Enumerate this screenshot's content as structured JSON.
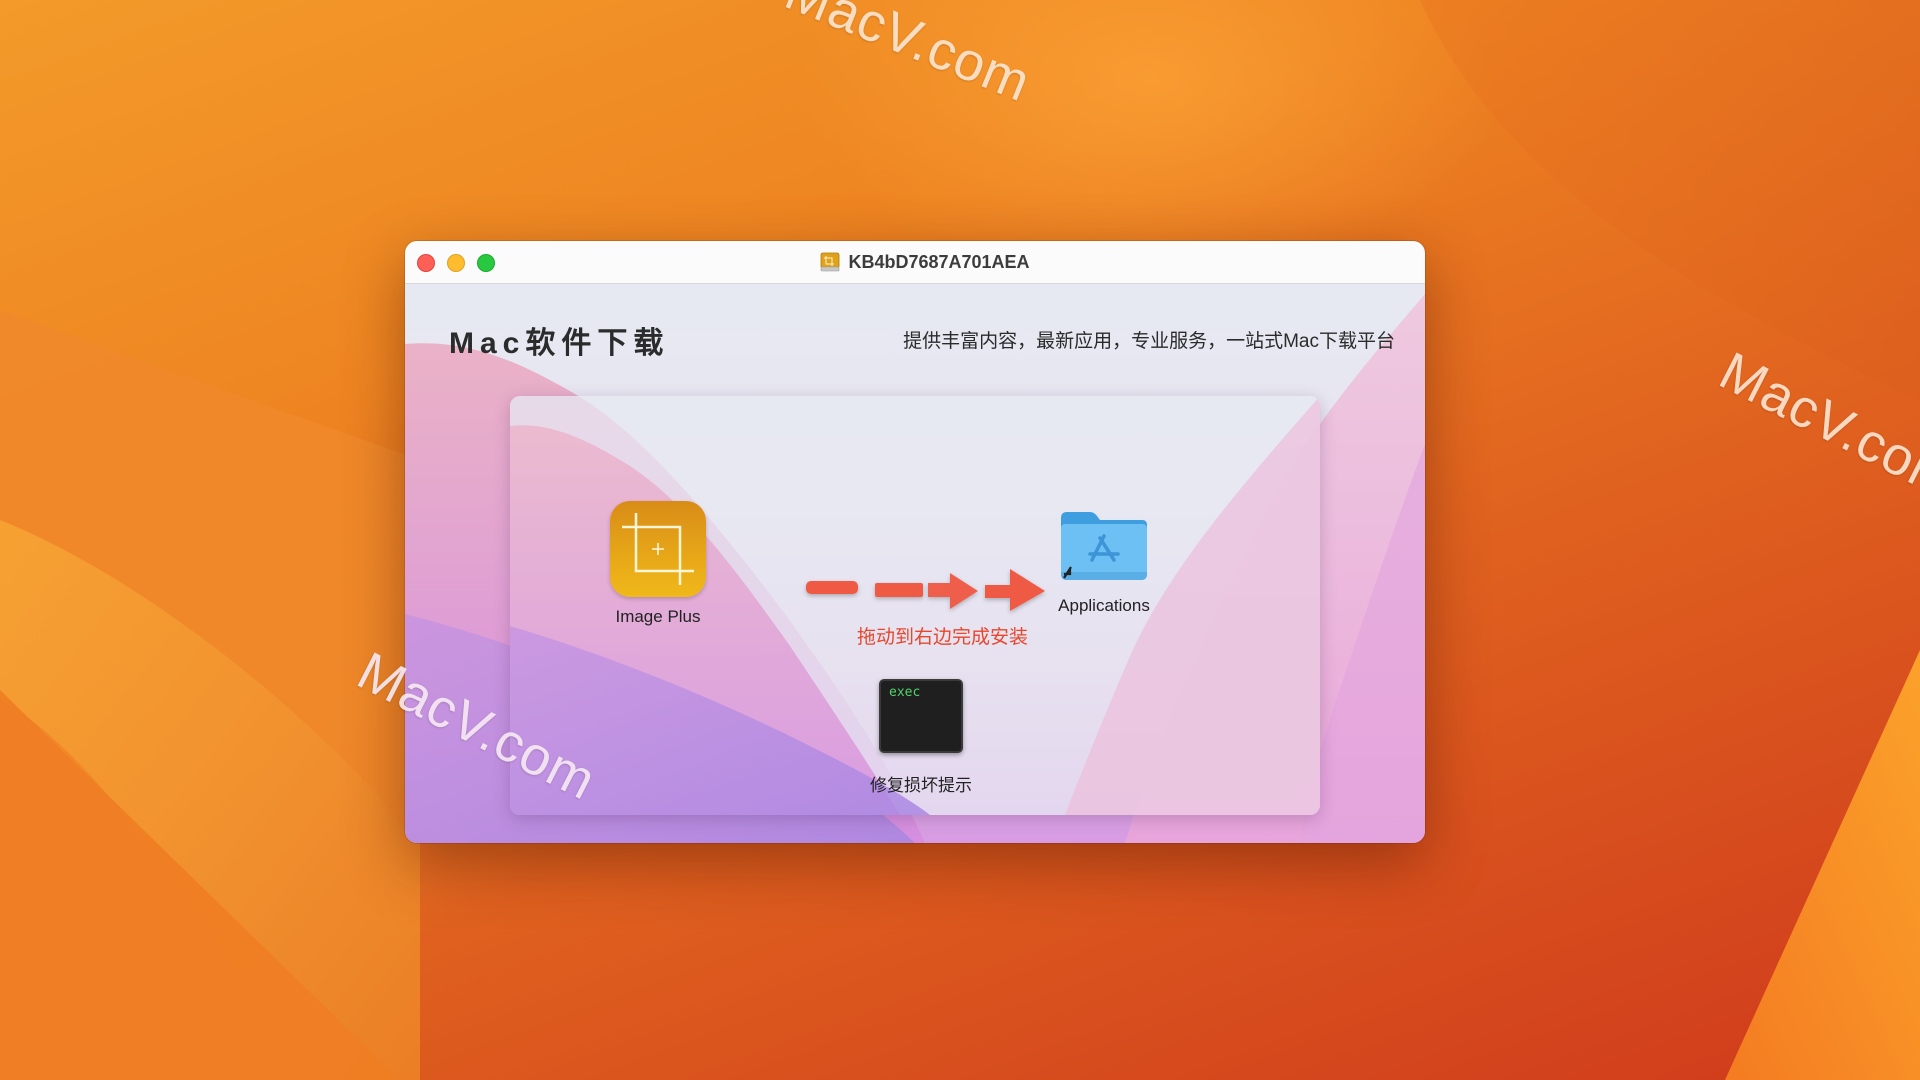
{
  "desktop": {
    "watermarks": [
      "MacV.com",
      "MacV.com",
      "MacV.com"
    ]
  },
  "window": {
    "title": "KB4bD7687A701AEA",
    "title_icon": "disk-image-icon",
    "controls": {
      "close": "close-button",
      "minimize": "minimize-button",
      "zoom": "zoom-button"
    }
  },
  "header": {
    "brand": "Mac软件下载",
    "tagline": "提供丰富内容，最新应用，专业服务，一站式Mac下载平台"
  },
  "installer": {
    "app": {
      "label": "Image Plus",
      "icon": "crop-app-icon"
    },
    "target": {
      "label": "Applications",
      "icon": "applications-folder-icon"
    },
    "hint": "拖动到右边完成安装",
    "fix": {
      "label": "修复损坏提示",
      "icon_text": "exec"
    }
  },
  "colors": {
    "accent_red": "#e8472c",
    "app_icon": "#e6a618",
    "folder_blue": "#62b8f0",
    "exec_green": "#4fd36b"
  }
}
